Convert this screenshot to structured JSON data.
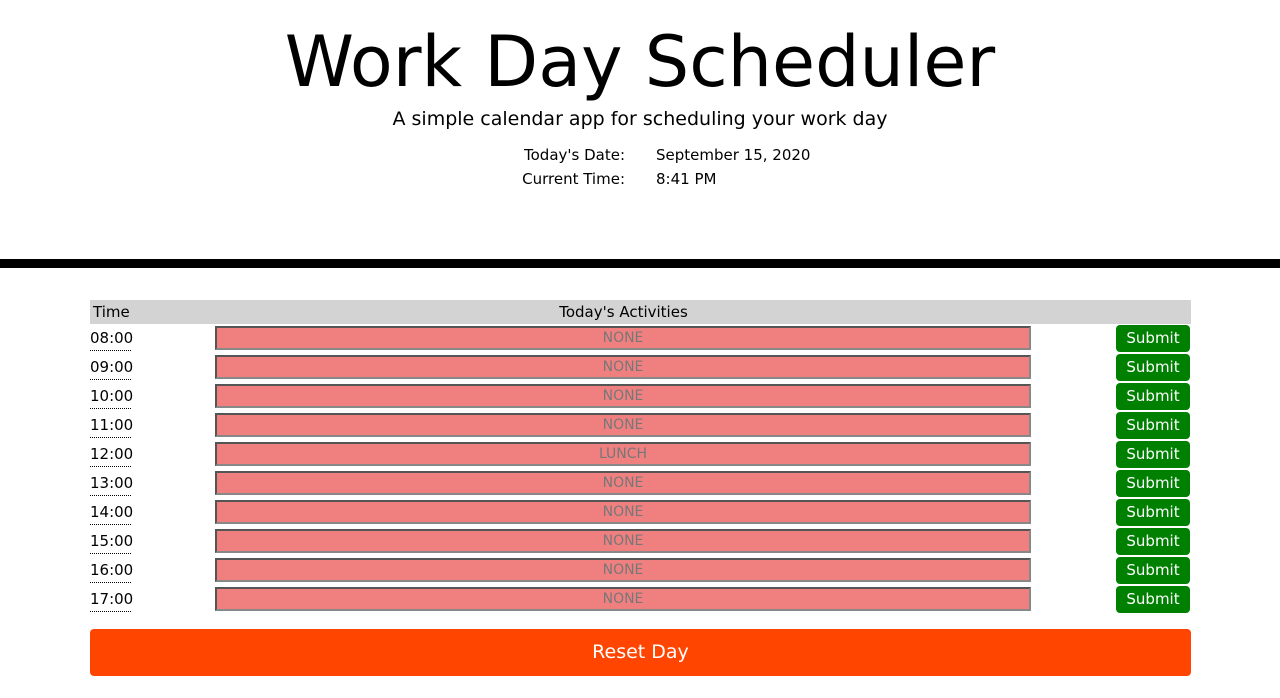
{
  "header": {
    "title": "Work Day Scheduler",
    "subtitle": "A simple calendar app for scheduling your work day",
    "date_label": "Today's Date:",
    "date_value": "September 15, 2020",
    "time_label": "Current Time:",
    "time_value": "8:41 PM"
  },
  "table": {
    "col_time": "Time",
    "col_activities": "Today's Activities",
    "rows": [
      {
        "time": "08:00",
        "activity": "NONE",
        "submit": "Submit"
      },
      {
        "time": "09:00",
        "activity": "NONE",
        "submit": "Submit"
      },
      {
        "time": "10:00",
        "activity": "NONE",
        "submit": "Submit"
      },
      {
        "time": "11:00",
        "activity": "NONE",
        "submit": "Submit"
      },
      {
        "time": "12:00",
        "activity": "LUNCH",
        "submit": "Submit"
      },
      {
        "time": "13:00",
        "activity": "NONE",
        "submit": "Submit"
      },
      {
        "time": "14:00",
        "activity": "NONE",
        "submit": "Submit"
      },
      {
        "time": "15:00",
        "activity": "NONE",
        "submit": "Submit"
      },
      {
        "time": "16:00",
        "activity": "NONE",
        "submit": "Submit"
      },
      {
        "time": "17:00",
        "activity": "NONE",
        "submit": "Submit"
      }
    ]
  },
  "reset_label": "Reset Day",
  "colors": {
    "past": "#f08080",
    "submit": "#008000",
    "reset": "#ff4500"
  }
}
